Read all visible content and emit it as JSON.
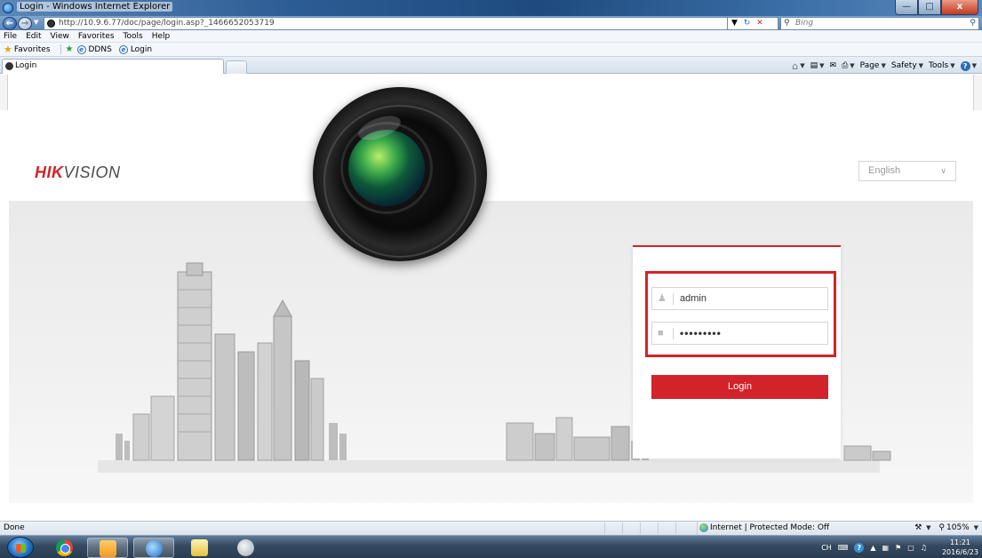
{
  "window": {
    "title": "Login - Windows Internet Explorer",
    "btn_minimize": "—",
    "btn_maximize": "□",
    "btn_close": "x"
  },
  "address": {
    "url": "http://10.9.6.77/doc/page/login.asp?_1466652053719",
    "search_placeholder": "Bing",
    "search_icon": "magnifier-icon"
  },
  "menu": [
    "File",
    "Edit",
    "View",
    "Favorites",
    "Tools",
    "Help"
  ],
  "favorites": {
    "label": "Favorites",
    "links": [
      "DDNS",
      "Login"
    ]
  },
  "tab": {
    "label": "Login"
  },
  "command_bar": [
    "Page",
    "Safety",
    "Tools"
  ],
  "page": {
    "logo_hik": "HIK",
    "logo_vision": "VISION",
    "language": "English",
    "username": "admin",
    "password_mask": "•••••••••",
    "login_label": "Login"
  },
  "status": {
    "left": "Done",
    "zone": "Internet | Protected Mode: Off",
    "zoom": "105%"
  },
  "taskbar": {
    "time": "11:21",
    "date": "2016/6/23",
    "lang": "CH"
  },
  "colors": {
    "brand_red": "#d2232a"
  }
}
